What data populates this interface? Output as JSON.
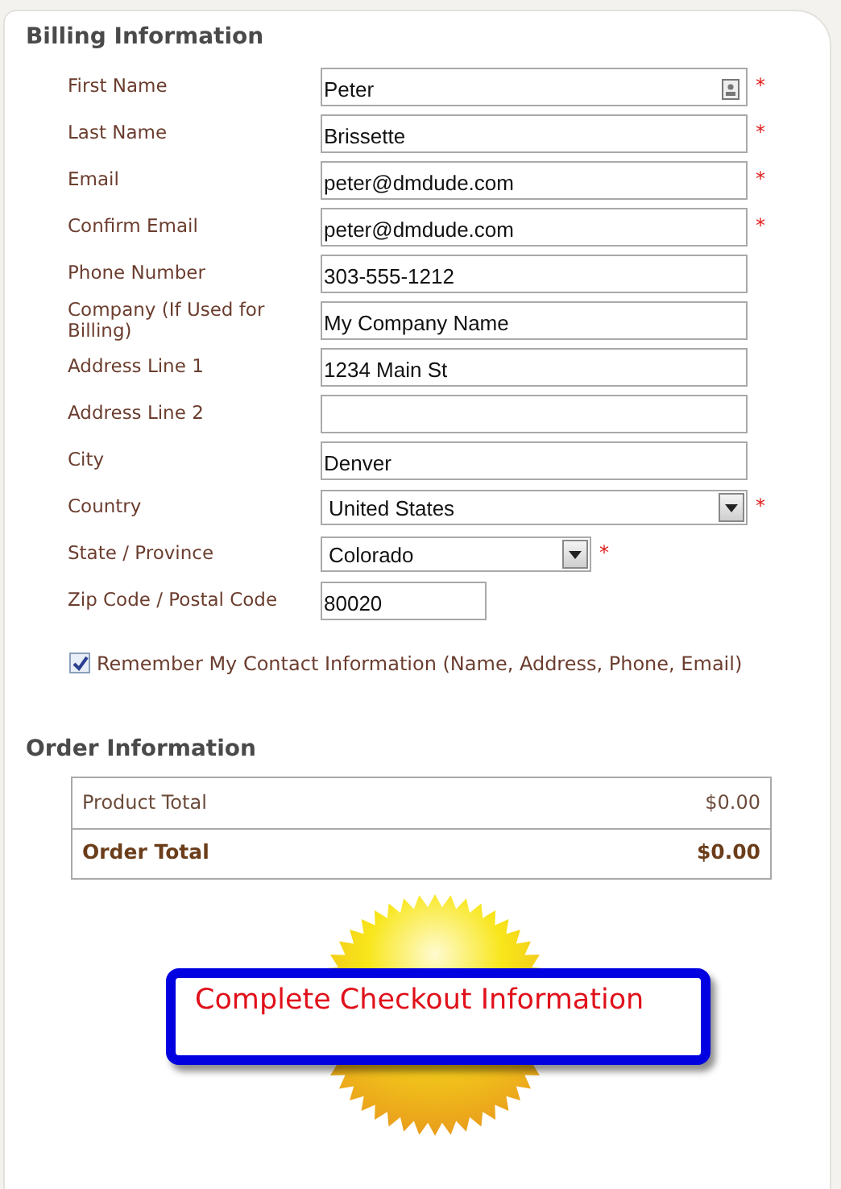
{
  "billing": {
    "title": "Billing Information",
    "fields": [
      {
        "label": "First Name",
        "kind": "text",
        "value": "Peter",
        "required": true,
        "autofill_icon": true
      },
      {
        "label": "Last Name",
        "kind": "text",
        "value": "Brissette",
        "required": true
      },
      {
        "label": "Email",
        "kind": "text",
        "value": "peter@dmdude.com",
        "required": true
      },
      {
        "label": "Confirm Email",
        "kind": "text",
        "value": "peter@dmdude.com",
        "required": true
      },
      {
        "label": "Phone Number",
        "kind": "text",
        "value": "303-555-1212",
        "required": false
      },
      {
        "label": "Company (If Used for Billing)",
        "kind": "text",
        "value": "My Company Name",
        "required": false
      },
      {
        "label": "Address Line 1",
        "kind": "text",
        "value": "1234 Main St",
        "required": false
      },
      {
        "label": "Address Line 2",
        "kind": "text",
        "required": false
      },
      {
        "label": "City",
        "kind": "text",
        "value": "Denver",
        "required": false
      },
      {
        "label": "Country",
        "kind": "select",
        "value": "United States",
        "required": true
      },
      {
        "label": "State / Province",
        "kind": "short-select",
        "value": "Colorado",
        "required": true
      },
      {
        "label": "Zip Code / Postal Code",
        "kind": "short-text",
        "value": "80020",
        "required": false
      }
    ],
    "required_mark": "*",
    "remember": {
      "label": "Remember My Contact Information (Name, Address, Phone, Email)",
      "checked": true
    }
  },
  "order": {
    "title": "Order Information",
    "rows": [
      {
        "label": "Product Total",
        "amount": "$0.00",
        "total": false
      },
      {
        "label": "Order Total",
        "amount": "$0.00",
        "total": true
      }
    ]
  },
  "checkout_button": "Complete Checkout Information"
}
